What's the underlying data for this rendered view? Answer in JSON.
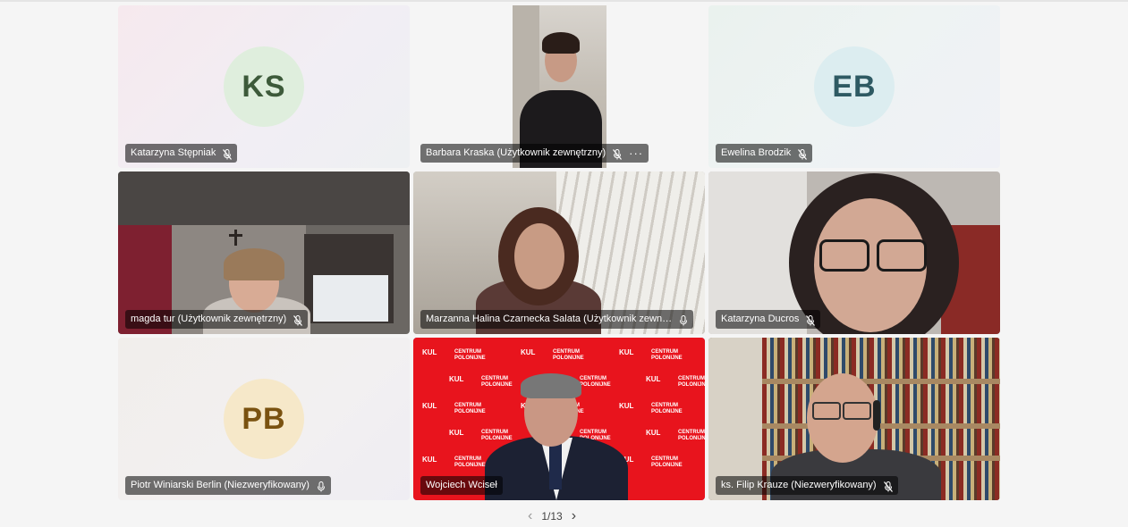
{
  "participants": [
    {
      "name": "Katarzyna Stępniak",
      "initials": "KS",
      "type": "avatar",
      "avatar_bg": "#dfeedd",
      "avatar_fg": "#3d5a3a",
      "muted": true
    },
    {
      "name": "Barbara Kraska (Użytkownik zewnętrzny)",
      "type": "video",
      "muted": true,
      "more": "···"
    },
    {
      "name": "Ewelina Brodzik",
      "initials": "EB",
      "type": "avatar",
      "avatar_bg": "#dcedf0",
      "avatar_fg": "#2e5a63",
      "muted": true
    },
    {
      "name": "magda tur (Użytkownik zewnętrzny)",
      "type": "video",
      "muted": true
    },
    {
      "name": "Marzanna Halina Czarnecka Salata (Użytkownik zewn…",
      "type": "video",
      "muted": false
    },
    {
      "name": "Katarzyna Ducros",
      "type": "video",
      "muted": true
    },
    {
      "name": "Piotr Winiarski Berlin (Niezweryfikowany)",
      "initials": "PB",
      "type": "avatar",
      "avatar_bg": "#f6e8c9",
      "avatar_fg": "#7a5210",
      "muted": false
    },
    {
      "name": "Wojciech Wciseł",
      "type": "video",
      "active_speaker": true,
      "muted": false
    },
    {
      "name": "ks. Filip Krauze (Niezweryfikowany)",
      "type": "video",
      "muted": true
    }
  ],
  "pager": {
    "label": "1/13"
  },
  "backdrop": {
    "logo": "KUL",
    "text_line1": "CENTRUM",
    "text_line2": "POLONIJNE"
  },
  "colors": {
    "active_outline": "#6b6bd6",
    "backdrop_red": "#e8141d"
  }
}
